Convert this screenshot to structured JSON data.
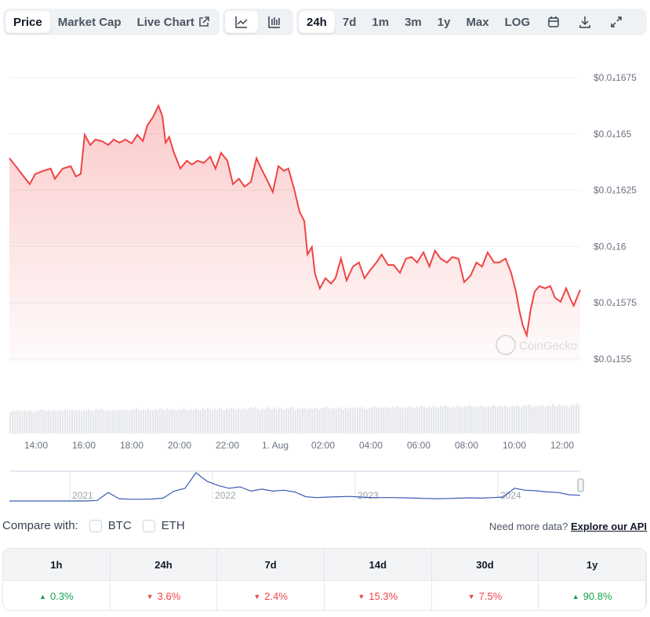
{
  "toolbar": {
    "view_tabs": [
      {
        "label": "Price",
        "active": true
      },
      {
        "label": "Market Cap",
        "active": false
      },
      {
        "label": "Live Chart",
        "active": false,
        "icon": "external-link-icon"
      }
    ],
    "chart_type_buttons": [
      {
        "icon": "line-chart-icon",
        "active": true
      },
      {
        "icon": "candlestick-chart-icon",
        "active": false
      }
    ],
    "range_tabs": [
      {
        "label": "24h",
        "active": true
      },
      {
        "label": "7d"
      },
      {
        "label": "1m"
      },
      {
        "label": "3m"
      },
      {
        "label": "1y"
      },
      {
        "label": "Max"
      },
      {
        "label": "LOG"
      }
    ],
    "action_icons": [
      "calendar-icon",
      "download-icon",
      "expand-icon"
    ]
  },
  "watermark": "CoinGecko",
  "colors": {
    "line": "#ef4444",
    "navigator_line": "#3b5bb5",
    "up": "#16a34a",
    "down": "#ef4444"
  },
  "chart_data": {
    "type": "line",
    "y_ticks": [
      {
        "value": 1.675e-05,
        "label": "$0.0₄1675"
      },
      {
        "value": 1.65e-05,
        "label": "$0.0₄165"
      },
      {
        "value": 1.625e-05,
        "label": "$0.0₄1625"
      },
      {
        "value": 1.6e-05,
        "label": "$0.0₄16"
      },
      {
        "value": 1.575e-05,
        "label": "$0.0₄1575"
      },
      {
        "value": 1.55e-05,
        "label": "$0.0₄155"
      }
    ],
    "ylim": [
      1.55e-05,
      1.675e-05
    ],
    "x_ticks": [
      "14:00",
      "16:00",
      "18:00",
      "20:00",
      "22:00",
      "1. Aug",
      "02:00",
      "04:00",
      "06:00",
      "08:00",
      "10:00",
      "12:00"
    ],
    "grid": true,
    "series": [
      {
        "points": [
          [
            "12:53",
            1.6392e-05
          ],
          [
            "13:09",
            1.6357e-05
          ],
          [
            "13:29",
            1.6311e-05
          ],
          [
            "13:44",
            1.6277e-05
          ],
          [
            "13:58",
            1.6322e-05
          ],
          [
            "14:18",
            1.6336e-05
          ],
          [
            "14:37",
            1.6346e-05
          ],
          [
            "14:47",
            1.6301e-05
          ],
          [
            "15:07",
            1.6346e-05
          ],
          [
            "15:27",
            1.6357e-05
          ],
          [
            "15:40",
            1.6311e-05
          ],
          [
            "15:52",
            1.6322e-05
          ],
          [
            "16:02",
            1.6496e-05
          ],
          [
            "16:16",
            1.6451e-05
          ],
          [
            "16:29",
            1.6475e-05
          ],
          [
            "16:45",
            1.6468e-05
          ],
          [
            "17:01",
            1.6451e-05
          ],
          [
            "17:15",
            1.6475e-05
          ],
          [
            "17:29",
            1.6461e-05
          ],
          [
            "17:44",
            1.6475e-05
          ],
          [
            "18:00",
            1.6458e-05
          ],
          [
            "18:14",
            1.6496e-05
          ],
          [
            "18:28",
            1.6468e-05
          ],
          [
            "18:39",
            1.6538e-05
          ],
          [
            "18:53",
            1.6573e-05
          ],
          [
            "19:07",
            1.6625e-05
          ],
          [
            "19:17",
            1.6579e-05
          ],
          [
            "19:25",
            1.6461e-05
          ],
          [
            "19:34",
            1.6486e-05
          ],
          [
            "19:46",
            1.6416e-05
          ],
          [
            "20:02",
            1.6346e-05
          ],
          [
            "20:18",
            1.6381e-05
          ],
          [
            "20:31",
            1.6364e-05
          ],
          [
            "20:45",
            1.6381e-05
          ],
          [
            "21:01",
            1.6371e-05
          ],
          [
            "21:17",
            1.6399e-05
          ],
          [
            "21:30",
            1.6346e-05
          ],
          [
            "21:44",
            1.6416e-05
          ],
          [
            "22:00",
            1.6381e-05
          ],
          [
            "22:14",
            1.6277e-05
          ],
          [
            "22:29",
            1.6301e-05
          ],
          [
            "22:43",
            1.6266e-05
          ],
          [
            "22:59",
            1.6287e-05
          ],
          [
            "23:13",
            1.6392e-05
          ],
          [
            "23:25",
            1.6346e-05
          ],
          [
            "23:38",
            1.6301e-05
          ],
          [
            "23:54",
            1.6242e-05
          ],
          [
            "00:08",
            1.6357e-05
          ],
          [
            "00:22",
            1.6336e-05
          ],
          [
            "00:33",
            1.6346e-05
          ],
          [
            "00:47",
            1.6259e-05
          ],
          [
            "01:01",
            1.6155e-05
          ],
          [
            "01:13",
            1.6113e-05
          ],
          [
            "01:21",
            1.5964e-05
          ],
          [
            "01:32",
            1.5998e-05
          ],
          [
            "01:40",
            1.5877e-05
          ],
          [
            "01:52",
            1.5814e-05
          ],
          [
            "02:06",
            1.5859e-05
          ],
          [
            "02:20",
            1.5835e-05
          ],
          [
            "02:31",
            1.5859e-05
          ],
          [
            "02:45",
            1.5946e-05
          ],
          [
            "02:59",
            1.5849e-05
          ],
          [
            "03:15",
            1.5911e-05
          ],
          [
            "03:30",
            1.5929e-05
          ],
          [
            "03:44",
            1.5859e-05
          ],
          [
            "03:58",
            1.5894e-05
          ],
          [
            "04:14",
            1.5929e-05
          ],
          [
            "04:27",
            1.5964e-05
          ],
          [
            "04:43",
            1.5918e-05
          ],
          [
            "04:57",
            1.5918e-05
          ],
          [
            "05:13",
            1.5883e-05
          ],
          [
            "05:28",
            1.5946e-05
          ],
          [
            "05:42",
            1.5953e-05
          ],
          [
            "05:56",
            1.5929e-05
          ],
          [
            "06:12",
            1.5974e-05
          ],
          [
            "06:27",
            1.5911e-05
          ],
          [
            "06:41",
            1.5981e-05
          ],
          [
            "06:55",
            1.5946e-05
          ],
          [
            "07:11",
            1.5929e-05
          ],
          [
            "07:24",
            1.5953e-05
          ],
          [
            "07:40",
            1.5946e-05
          ],
          [
            "07:54",
            1.5842e-05
          ],
          [
            "08:10",
            1.587e-05
          ],
          [
            "08:25",
            1.5929e-05
          ],
          [
            "08:39",
            1.5911e-05
          ],
          [
            "08:53",
            1.5974e-05
          ],
          [
            "09:09",
            1.5929e-05
          ],
          [
            "09:22",
            1.5929e-05
          ],
          [
            "09:38",
            1.5946e-05
          ],
          [
            "09:52",
            1.5883e-05
          ],
          [
            "10:04",
            1.58e-05
          ],
          [
            "10:12",
            1.572e-05
          ],
          [
            "10:21",
            1.565e-05
          ],
          [
            "10:31",
            1.5605e-05
          ],
          [
            "10:41",
            1.572e-05
          ],
          [
            "10:51",
            1.58e-05
          ],
          [
            "11:03",
            1.5824e-05
          ],
          [
            "11:17",
            1.5814e-05
          ],
          [
            "11:30",
            1.5824e-05
          ],
          [
            "11:42",
            1.5772e-05
          ],
          [
            "11:56",
            1.5755e-05
          ],
          [
            "12:10",
            1.5814e-05
          ],
          [
            "12:21",
            1.5765e-05
          ],
          [
            "12:29",
            1.5737e-05
          ],
          [
            "12:45",
            1.5807e-05
          ]
        ]
      }
    ],
    "volume_relative": [
      0.78,
      0.8,
      0.79,
      0.82,
      0.8,
      0.81,
      0.83,
      0.8,
      0.82,
      0.84,
      0.81,
      0.83,
      0.82,
      0.85,
      0.83,
      0.84,
      0.86,
      0.83,
      0.85,
      0.84,
      0.87,
      0.85,
      0.86,
      0.88,
      0.85,
      0.9,
      0.87,
      0.89,
      0.88,
      0.9,
      0.87,
      0.89,
      0.88,
      0.9,
      0.89,
      0.88,
      0.91,
      0.89,
      0.92,
      0.9,
      0.93,
      0.91,
      0.92,
      0.94,
      0.92,
      0.95,
      0.93,
      0.94,
      0.96,
      0.94,
      0.95,
      0.97,
      0.95,
      0.96,
      0.98,
      0.96,
      0.97,
      0.99,
      0.97,
      1.0
    ],
    "navigator": {
      "x_labels": [
        "2021",
        "2022",
        "2023",
        "2024"
      ],
      "relative_values": [
        0,
        0,
        0,
        0,
        0,
        0,
        0,
        0,
        0.02,
        0.3,
        0.08,
        0.06,
        0.06,
        0.07,
        0.1,
        0.35,
        0.45,
        1.0,
        0.7,
        0.55,
        0.45,
        0.5,
        0.35,
        0.42,
        0.35,
        0.38,
        0.32,
        0.15,
        0.12,
        0.14,
        0.15,
        0.16,
        0.14,
        0.12,
        0.12,
        0.12,
        0.11,
        0.1,
        0.09,
        0.08,
        0.09,
        0.1,
        0.11,
        0.1,
        0.12,
        0.14,
        0.45,
        0.38,
        0.36,
        0.32,
        0.3,
        0.22,
        0.2
      ]
    }
  },
  "compare": {
    "label": "Compare with:",
    "options": [
      "BTC",
      "ETH"
    ]
  },
  "api": {
    "prompt": "Need more data?",
    "link": "Explore our API"
  },
  "performance": [
    {
      "period": "1h",
      "change": "0.3%",
      "dir": "up"
    },
    {
      "period": "24h",
      "change": "3.6%",
      "dir": "down"
    },
    {
      "period": "7d",
      "change": "2.4%",
      "dir": "down"
    },
    {
      "period": "14d",
      "change": "15.3%",
      "dir": "down"
    },
    {
      "period": "30d",
      "change": "7.5%",
      "dir": "down"
    },
    {
      "period": "1y",
      "change": "90.8%",
      "dir": "up"
    }
  ]
}
